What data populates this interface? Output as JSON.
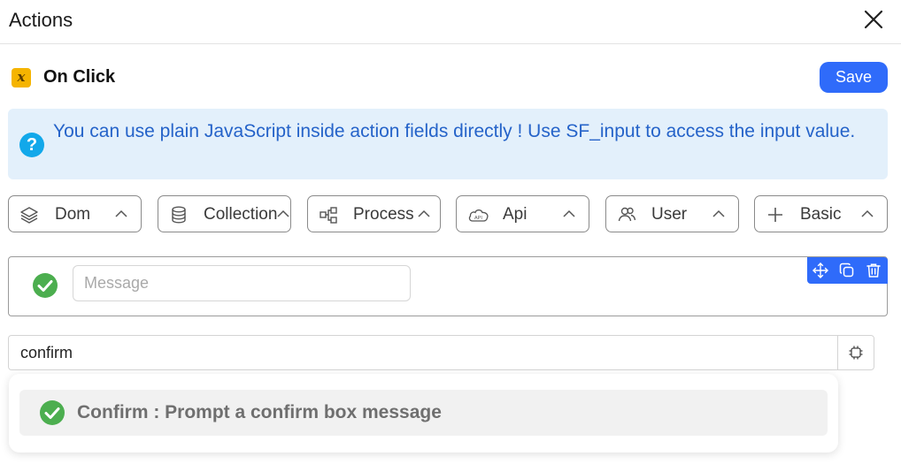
{
  "panel": {
    "title": "Actions"
  },
  "event": {
    "label": "On Click",
    "icon": "function-x-icon"
  },
  "toolbar": {
    "save_label": "Save"
  },
  "info": {
    "text": "You can use plain JavaScript inside action fields directly ! Use SF_input to access the input value.",
    "icon": "question-icon"
  },
  "categories": [
    {
      "label": "Dom",
      "icon": "layers-icon"
    },
    {
      "label": "Collection",
      "icon": "database-icon"
    },
    {
      "label": "Process",
      "icon": "flow-icon"
    },
    {
      "label": "Api",
      "icon": "cloud-api-icon"
    },
    {
      "label": "User",
      "icon": "users-icon"
    },
    {
      "label": "Basic",
      "icon": "plus-icon"
    }
  ],
  "action_card": {
    "message_placeholder": "Message",
    "message_value": "",
    "icon": "check-circle-icon"
  },
  "search": {
    "value": "confirm"
  },
  "suggestions": [
    {
      "label": "Confirm : Prompt a confirm box message",
      "icon": "check-circle-icon"
    }
  ],
  "colors": {
    "accent": "#2f6bfa",
    "info_bg": "#e3f0fb",
    "info_text": "#2563c9",
    "success": "#4cae4f",
    "event_badge": "#f5b400"
  }
}
